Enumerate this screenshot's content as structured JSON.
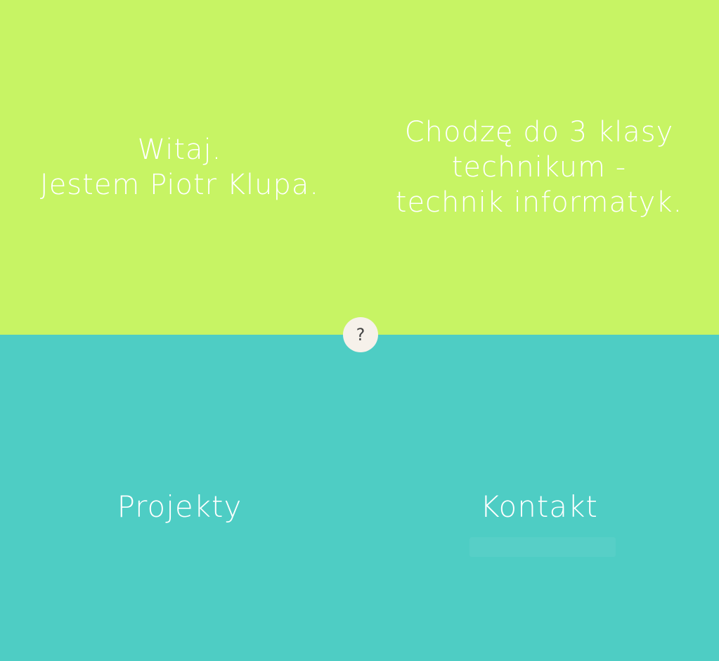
{
  "greeting": {
    "line1": "Witaj.",
    "line2": "Jestem Piotr Klupa."
  },
  "school": {
    "line1": "Chodzę do 3 klasy",
    "line2": "technikum -",
    "line3": "technik informatyk."
  },
  "nav": {
    "projects_label": "Projekty",
    "contact_label": "Kontakt"
  },
  "help_button": {
    "label": "?"
  },
  "colors": {
    "top_background": "#c7f464",
    "bottom_background": "#4ecdc4",
    "text": "#ffffff",
    "help_background": "#f6f1ea"
  }
}
